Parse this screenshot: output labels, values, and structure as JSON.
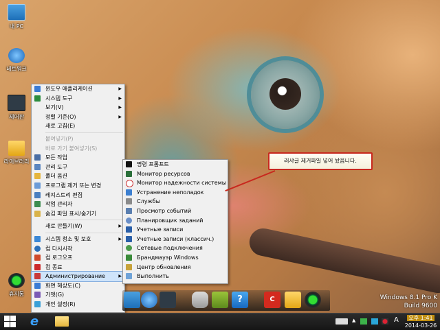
{
  "desktop": {
    "icons": [
      {
        "label": "내 PC"
      },
      {
        "label": "네트워크"
      },
      {
        "label": "제어판"
      },
      {
        "label": "라이브러리"
      },
      {
        "label": "휴지통"
      }
    ]
  },
  "context_menu": {
    "items": [
      {
        "label": "윈도우 애플리케이션",
        "submenu": true
      },
      {
        "label": "시스템 도구",
        "submenu": true
      },
      {
        "label": "보기(V)",
        "submenu": true
      },
      {
        "label": "정렬 기준(O)",
        "submenu": true
      },
      {
        "label": "새로 고침(E)"
      },
      {
        "label": "붙여넣기(P)",
        "disabled": true
      },
      {
        "label": "바로 가기 붙여넣기(S)",
        "disabled": true
      },
      {
        "label": "모든 작업"
      },
      {
        "label": "관리 도구"
      },
      {
        "label": "폴더 옵션"
      },
      {
        "label": "프로그램 제거 또는 변경"
      },
      {
        "label": "레지스트리 편집"
      },
      {
        "label": "작업 관리자"
      },
      {
        "label": "숨김 파일 표시/숨기기"
      },
      {
        "label": "새로 만들기(W)",
        "submenu": true
      },
      {
        "label": "시스템 청소 및 보호",
        "submenu": true
      },
      {
        "label": "컴 다시시작"
      },
      {
        "label": "컴 로그오프"
      },
      {
        "label": "컴 종료"
      },
      {
        "label": "Администрирование",
        "submenu": true,
        "selected": true
      },
      {
        "label": "화면 해상도(C)"
      },
      {
        "label": "가젯(G)"
      },
      {
        "label": "개인 설정(R)"
      }
    ]
  },
  "submenu": {
    "items": [
      {
        "label": "명령 프롬프트"
      },
      {
        "label": "Монитор ресурсов"
      },
      {
        "label": "Монитор надежности системы"
      },
      {
        "label": "Устранение неполадок"
      },
      {
        "label": "Службы"
      },
      {
        "label": "Просмотр событий"
      },
      {
        "label": "Планировщик заданий"
      },
      {
        "label": "Учетные записи"
      },
      {
        "label": "Учетные записи (классич.)"
      },
      {
        "label": "Сетевые подключения"
      },
      {
        "label": "Брандмауэр Windows"
      },
      {
        "label": "Центр обновления"
      },
      {
        "label": "Выполнить"
      }
    ]
  },
  "callout": {
    "text": "러샤글 제거파일 넣어 놨읍니다."
  },
  "dock": {
    "icons": [
      "monitor-icon",
      "globe-icon",
      "control-panel-icon",
      "gamepad-icon",
      "game-controller-icon",
      "help-icon",
      "ccleaner-icon",
      "folder-icon",
      "recycle-icon"
    ]
  },
  "watermark": {
    "line1": "Windows 8.1 Pro K",
    "line2": "Build 9600"
  },
  "taskbar": {
    "ime_mode": "A",
    "clock_time": "오후 1:41",
    "clock_date": "2014-03-26"
  }
}
